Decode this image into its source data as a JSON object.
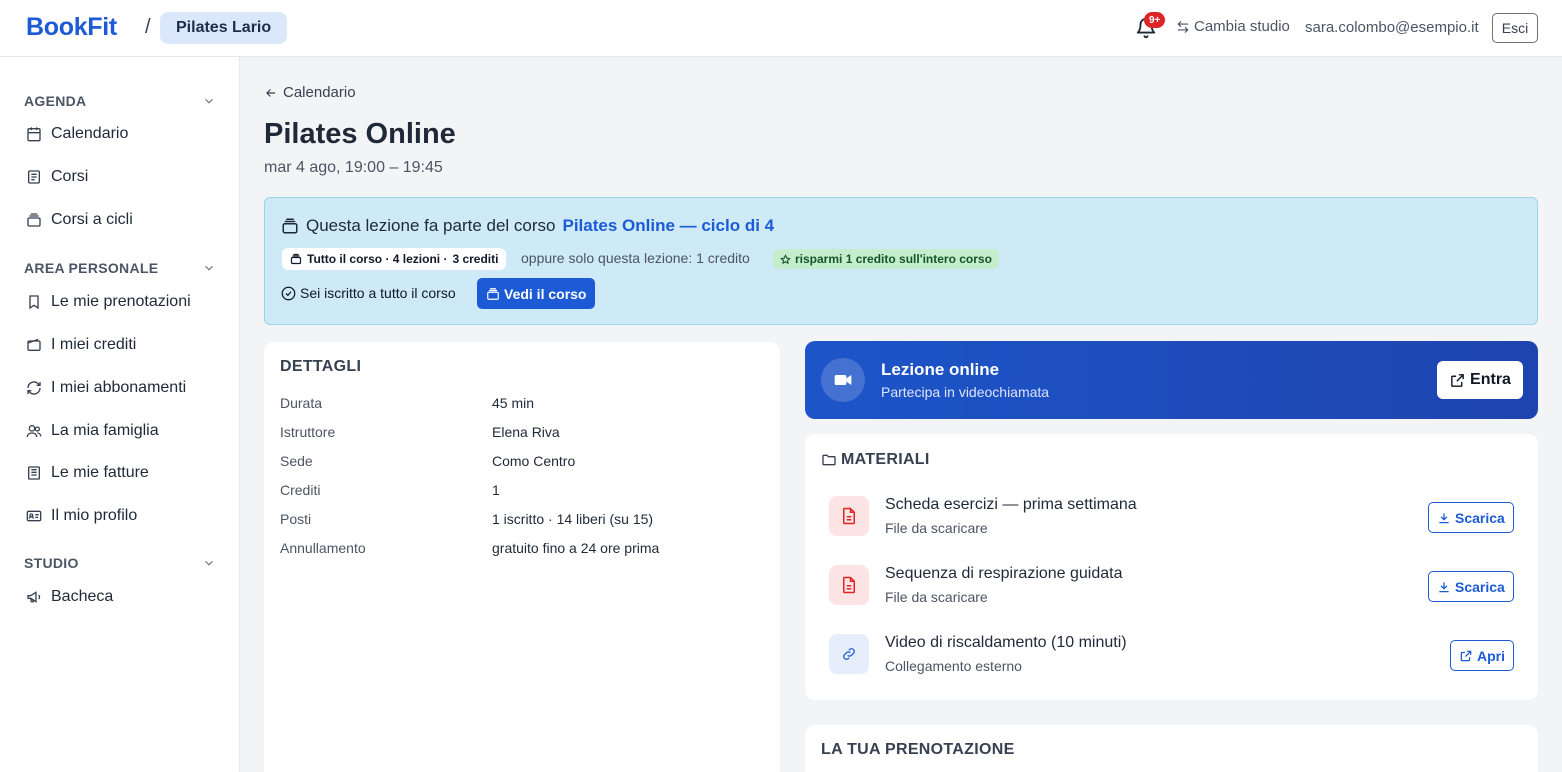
{
  "header": {
    "brand": "BookFit",
    "separator": "/",
    "studio": "Pilates Lario",
    "notifications_badge": "9+",
    "switch_studio": "Cambia studio",
    "user_email": "sara.colombo@esempio.it",
    "logout": "Esci"
  },
  "sidebar": {
    "sections": [
      {
        "title": "AGENDA",
        "items": [
          {
            "label": "Calendario",
            "icon": "calendar-icon"
          },
          {
            "label": "Corsi",
            "icon": "list-icon"
          },
          {
            "label": "Corsi a cicli",
            "icon": "stack-icon"
          }
        ]
      },
      {
        "title": "AREA PERSONALE",
        "items": [
          {
            "label": "Le mie prenotazioni",
            "icon": "bookmark-icon"
          },
          {
            "label": "I miei crediti",
            "icon": "wallet-icon"
          },
          {
            "label": "I miei abbonamenti",
            "icon": "refresh-icon"
          },
          {
            "label": "La mia famiglia",
            "icon": "users-icon"
          },
          {
            "label": "Le mie fatture",
            "icon": "receipt-icon"
          },
          {
            "label": "Il mio profilo",
            "icon": "id-card-icon"
          }
        ]
      },
      {
        "title": "STUDIO",
        "items": [
          {
            "label": "Bacheca",
            "icon": "megaphone-icon"
          }
        ]
      }
    ]
  },
  "main": {
    "back_label": "Calendario",
    "title": "Pilates Online",
    "subtitle": "mar 4 ago, 19:00 – 19:45",
    "course_banner": {
      "text": "Questa lezione fa parte del corso",
      "course_link": "Pilates Online — ciclo di 4",
      "chip_course": "Tutto il corso · 4 lezioni ·",
      "chip_credits": "3 crediti",
      "or_single": "oppure solo questa lezione: 1 credito",
      "savings": "risparmi 1 credito sull'intero corso",
      "enrolled": "Sei iscritto a tutto il corso",
      "view_course": "Vedi il corso"
    },
    "details": {
      "title": "DETTAGLI",
      "rows": [
        {
          "label": "Durata",
          "value": "45 min"
        },
        {
          "label": "Istruttore",
          "value": "Elena Riva"
        },
        {
          "label": "Sede",
          "value": "Como Centro"
        },
        {
          "label": "Crediti",
          "value": "1"
        },
        {
          "label": "Posti",
          "value": "1 iscritto · 14 liberi (su 15)"
        },
        {
          "label": "Annullamento",
          "value": "gratuito fino a 24 ore prima"
        }
      ]
    },
    "online": {
      "title": "Lezione online",
      "subtitle": "Partecipa in videochiamata",
      "enter": "Entra"
    },
    "materials": {
      "title": "MATERIALI",
      "items": [
        {
          "name": "Scheda esercizi — prima settimana",
          "sub": "File da scaricare",
          "action": "Scarica",
          "kind": "pdf"
        },
        {
          "name": "Sequenza di respirazione guidata",
          "sub": "File da scaricare",
          "action": "Scarica",
          "kind": "pdf"
        },
        {
          "name": "Video di riscaldamento (10 minuti)",
          "sub": "Collegamento esterno",
          "action": "Apri",
          "kind": "link"
        }
      ]
    },
    "booking": {
      "title": "LA TUA PRENOTAZIONE"
    }
  },
  "colors": {
    "brand": "#1d5bd6",
    "banner_bg": "#cdeaf6",
    "online_bg": "#1d55c8",
    "savings_bg": "#c4eecb",
    "badge": "#dc2626"
  }
}
